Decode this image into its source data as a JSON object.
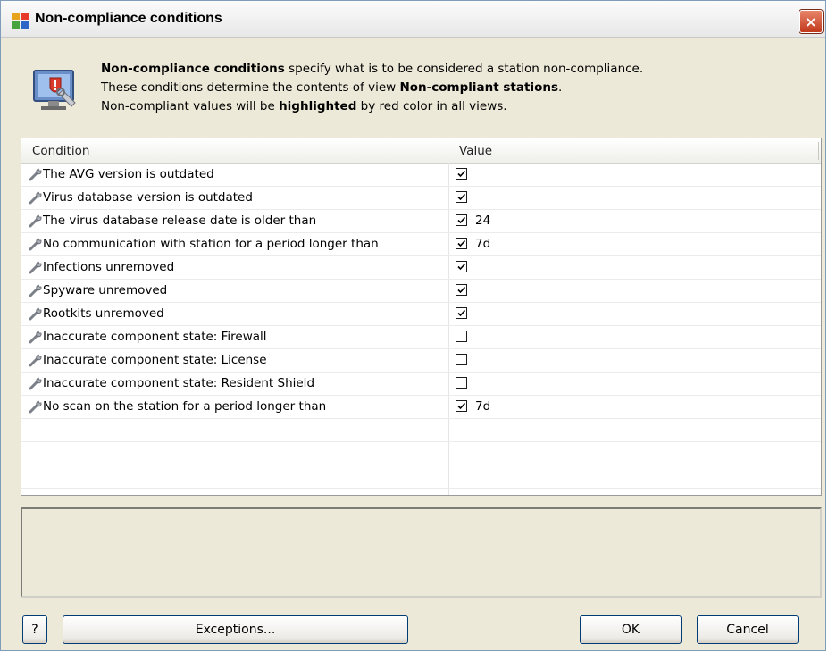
{
  "window": {
    "title": "Non-compliance conditions",
    "close_label": "×"
  },
  "description": {
    "line1_bold": "Non-compliance conditions",
    "line1_rest": " specify what is to be considered a station non-compliance.",
    "line2_pre": "These conditions determine the contents of view ",
    "line2_bold": "Non-compliant stations",
    "line2_post": ".",
    "line3_pre": "Non-compliant values will be ",
    "line3_bold": "highlighted",
    "line3_post": " by red color in all views."
  },
  "table": {
    "headers": {
      "condition": "Condition",
      "value": "Value"
    },
    "rows": [
      {
        "condition": "The AVG version is outdated",
        "checked": true,
        "value": ""
      },
      {
        "condition": "Virus database version is outdated",
        "checked": true,
        "value": ""
      },
      {
        "condition": "The virus database release date is older than",
        "checked": true,
        "value": "24"
      },
      {
        "condition": "No communication with station for a period longer than",
        "checked": true,
        "value": "7d"
      },
      {
        "condition": "Infections unremoved",
        "checked": true,
        "value": ""
      },
      {
        "condition": "Spyware unremoved",
        "checked": true,
        "value": ""
      },
      {
        "condition": "Rootkits unremoved",
        "checked": true,
        "value": ""
      },
      {
        "condition": "Inaccurate component state: Firewall",
        "checked": false,
        "value": ""
      },
      {
        "condition": "Inaccurate component state: License",
        "checked": false,
        "value": ""
      },
      {
        "condition": "Inaccurate component state: Resident Shield",
        "checked": false,
        "value": ""
      },
      {
        "condition": "No scan on the station for a period longer than",
        "checked": true,
        "value": "7d"
      }
    ]
  },
  "buttons": {
    "help": "?",
    "exceptions": "Exceptions...",
    "ok": "OK",
    "cancel": "Cancel"
  },
  "icons": {
    "app": "avg-app-icon",
    "close": "close-icon",
    "info": "monitor-shield-icon",
    "row": "wrench-icon"
  },
  "colors": {
    "dialog_bg": "#ece9d8",
    "close_button": "#c1391b",
    "button_border": "#003c74"
  }
}
